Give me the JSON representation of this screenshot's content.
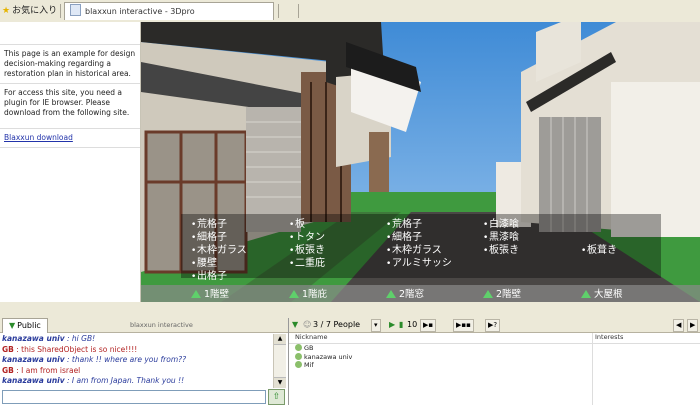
{
  "browser": {
    "favorites_label": "お気に入り",
    "tab_title": "blaxxun interactive - 3Dpro"
  },
  "left_panel": {
    "intro": "This page is an example for design decision-making regarding a restoration plan in historical area.",
    "plugin_note": "For access this site, you need a plugin for IE browser. Please download from the following site.",
    "download_link": "Blaxxun download"
  },
  "scene": {
    "options": [
      [
        "荒格子",
        "細格子",
        "木枠ガラス",
        "腰壁",
        "出格子"
      ],
      [
        "板",
        "トタン",
        "板張き",
        "二重庇"
      ],
      [
        "荒格子",
        "細格子",
        "木枠ガラス",
        "アルミサッシ"
      ],
      [
        "白漆喰",
        "黒漆喰",
        "板張き"
      ],
      [
        "板葺き"
      ]
    ],
    "categories": [
      "1階壁",
      "1階庇",
      "2階窓",
      "2階壁",
      "大屋根"
    ]
  },
  "chat": {
    "tab_label": "Public",
    "brand": "blaxxun interactive",
    "messages": [
      {
        "user": "kanazawa univ",
        "text": ": hi GB!",
        "style": "1"
      },
      {
        "user": "GB",
        "text": ": this SharedObject is so nice!!!!",
        "style": "2"
      },
      {
        "user": "kanazawa univ",
        "text": ": thank !! where are you from??",
        "style": "1"
      },
      {
        "user": "GB",
        "text": ": I am from israel",
        "style": "2"
      },
      {
        "user": "kanazawa univ",
        "text": ": I am from Japan. Thank you !!",
        "style": "1"
      }
    ]
  },
  "people": {
    "count_label": "3 / 7 People",
    "num_label": "10",
    "nickname_header": "Nickname",
    "interests_header": "Interests",
    "list": [
      "GB",
      "kanazawa univ",
      "Mif"
    ]
  }
}
